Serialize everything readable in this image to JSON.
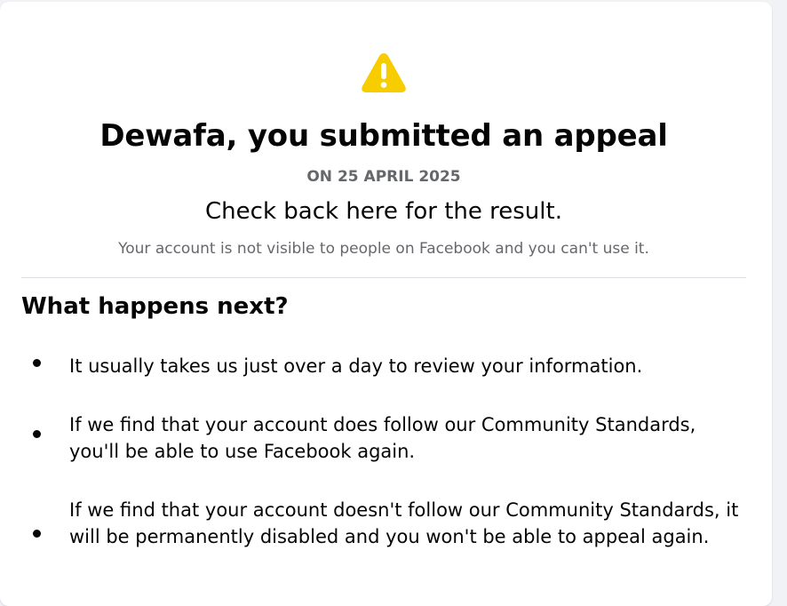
{
  "icons": {
    "warning": "warning-icon",
    "bullet": "bullet-icon"
  },
  "colors": {
    "warning_yellow": "#f7cd00",
    "secondary_text": "#65676b",
    "primary_text": "#050505"
  },
  "header": {
    "title": "Dewafa, you submitted an appeal",
    "date": "ON 25 APRIL 2025",
    "check_back": "Check back here for the result.",
    "visibility_note": "Your account is not visible to people on Facebook and you can't use it."
  },
  "next_steps": {
    "heading": "What happens next?",
    "items": [
      "It usually takes us just over a day to review your information.",
      "If we find that your account does follow our Community Standards, you'll be able to use Facebook again.",
      "If we find that your account doesn't follow our Community Standards, it will be permanently disabled and you won't be able to appeal again."
    ]
  }
}
